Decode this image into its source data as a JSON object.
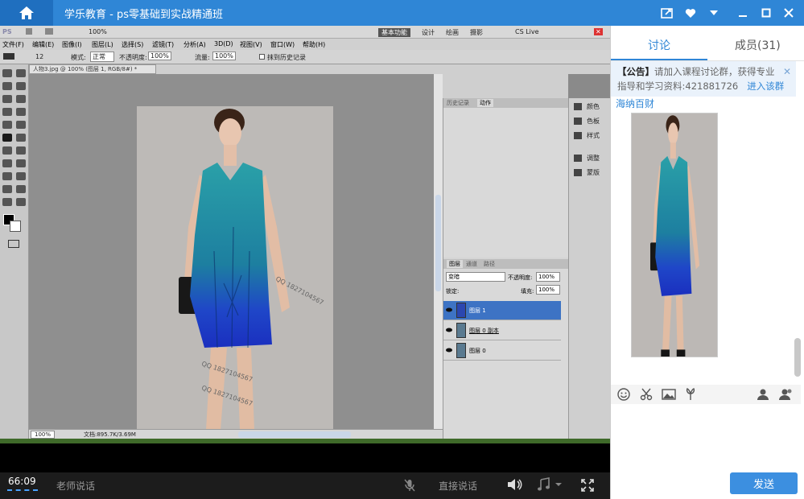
{
  "window": {
    "title": "学乐教育 - ps零基础到实战精通班",
    "home_icon": "home-icon",
    "controls": [
      "share-icon",
      "heart-icon",
      "dropdown-icon",
      "minimize-icon",
      "maximize-icon",
      "close-icon"
    ]
  },
  "photoshop": {
    "menus": [
      "文件(F)",
      "编辑(E)",
      "图像(I)",
      "图层(L)",
      "选择(S)",
      "滤镜(T)",
      "分析(A)",
      "3D(D)",
      "视图(V)",
      "窗口(W)",
      "帮助(H)"
    ],
    "zoom_top": "100%",
    "workspace_buttons": [
      "基本功能",
      "设计",
      "绘画",
      "摄影"
    ],
    "cs_live": "CS Live",
    "options": {
      "brush_size": "12",
      "mode_label": "模式:",
      "mode_value": "正常",
      "opacity_label": "不透明度:",
      "opacity_value": "100%",
      "flow_label": "流量:",
      "flow_value": "100%",
      "erase_history": "抹到历史记录"
    },
    "document_tab": "人物3.jpg @ 100% (图层 1, RGB/8#) *",
    "status_zoom": "100%",
    "status_doc": "文档:895.7K/3.69M",
    "history_tabs": [
      "历史记录",
      "动作"
    ],
    "layers_tabs": [
      "图层",
      "通道",
      "路径"
    ],
    "blend_mode": "变暗",
    "opacity_label": "不透明度:",
    "opacity_value": "100%",
    "lock_label": "锁定:",
    "fill_label": "填充:",
    "fill_value": "100%",
    "layers": [
      "图层 1",
      "图层 0 副本",
      "图层 0"
    ],
    "dock": [
      "颜色",
      "色板",
      "样式",
      "调整",
      "蒙版"
    ],
    "watermark": "QQ 1827104567"
  },
  "player": {
    "time": "66:09",
    "teacher_talk": "老师说话",
    "direct_talk": "直接说话"
  },
  "chat": {
    "tab_discussion": "讨论",
    "tab_members": "成员(31)",
    "notice_bold": "【公告】",
    "notice_text_1": "请加入课程讨论群，获得专业",
    "notice_text_2": "指导和学习资料:421881726",
    "notice_link": "进入该群",
    "sender": "海纳百财",
    "send_button": "发送"
  },
  "colors": {
    "accent": "#2f86d6",
    "layer_selected": "#3d73c4",
    "dress": "#1d7fa0"
  }
}
